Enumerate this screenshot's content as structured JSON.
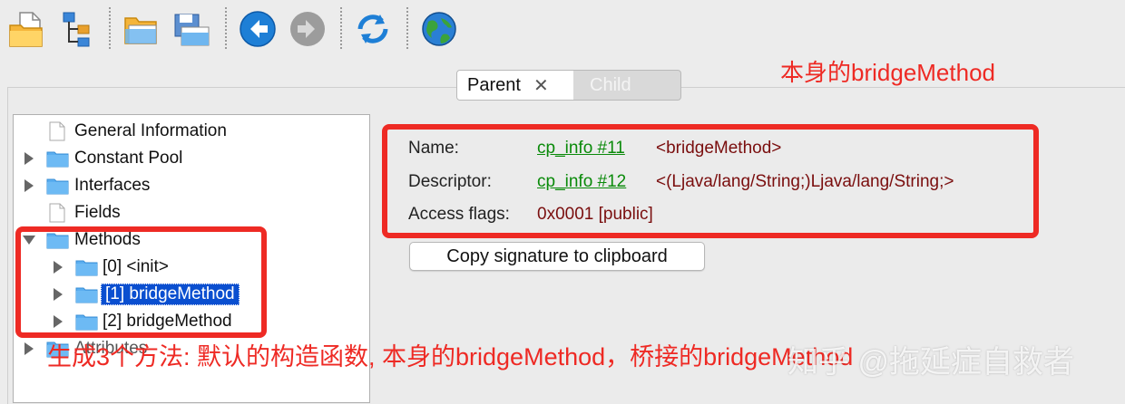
{
  "toolbar": {
    "buttons": [
      {
        "name": "open-file-icon"
      },
      {
        "name": "tree-structure-icon"
      },
      {
        "name": "open-folder-icon"
      },
      {
        "name": "save-icon"
      },
      {
        "name": "back-icon"
      },
      {
        "name": "forward-icon"
      },
      {
        "name": "refresh-icon"
      },
      {
        "name": "web-icon"
      }
    ]
  },
  "tabs": [
    {
      "label": "Parent",
      "active": true,
      "close": "✕"
    },
    {
      "label": "Child",
      "active": false
    }
  ],
  "tree": {
    "items": [
      {
        "label": "General Information",
        "icon": "document-icon",
        "expand": "none"
      },
      {
        "label": "Constant Pool",
        "icon": "folder-icon",
        "expand": "collapsed"
      },
      {
        "label": "Interfaces",
        "icon": "folder-icon",
        "expand": "collapsed"
      },
      {
        "label": "Fields",
        "icon": "document-icon",
        "expand": "none"
      },
      {
        "label": "Methods",
        "icon": "folder-icon",
        "expand": "expanded"
      },
      {
        "label": "[0] <init>",
        "icon": "folder-icon",
        "expand": "collapsed",
        "child": true
      },
      {
        "label": "[1] bridgeMethod",
        "icon": "folder-icon",
        "expand": "collapsed",
        "child": true,
        "selected": true
      },
      {
        "label": "[2] bridgeMethod",
        "icon": "folder-icon",
        "expand": "collapsed",
        "child": true
      },
      {
        "label": "Attributes",
        "icon": "folder-icon",
        "expand": "collapsed"
      }
    ]
  },
  "detail": {
    "name_label": "Name:",
    "name_link": "cp_info #11",
    "name_value": "<bridgeMethod>",
    "descriptor_label": "Descriptor:",
    "descriptor_link": "cp_info #12",
    "descriptor_value": "<(Ljava/lang/String;)Ljava/lang/String;>",
    "access_label": "Access flags:",
    "access_value": "0x0001 [public]",
    "copy_button": "Copy signature to clipboard"
  },
  "annotations": {
    "top": "本身的bridgeMethod",
    "bottom": "生成3个方法: 默认的构造函数, 本身的bridgeMethod，桥接的bridgeMethod",
    "color": "#ee2a24"
  },
  "watermark": "知乎 @拖延症自救者",
  "colors": {
    "link": "#0a8a0a",
    "value": "#7a0e0e",
    "selection": "#0a4fd0"
  }
}
